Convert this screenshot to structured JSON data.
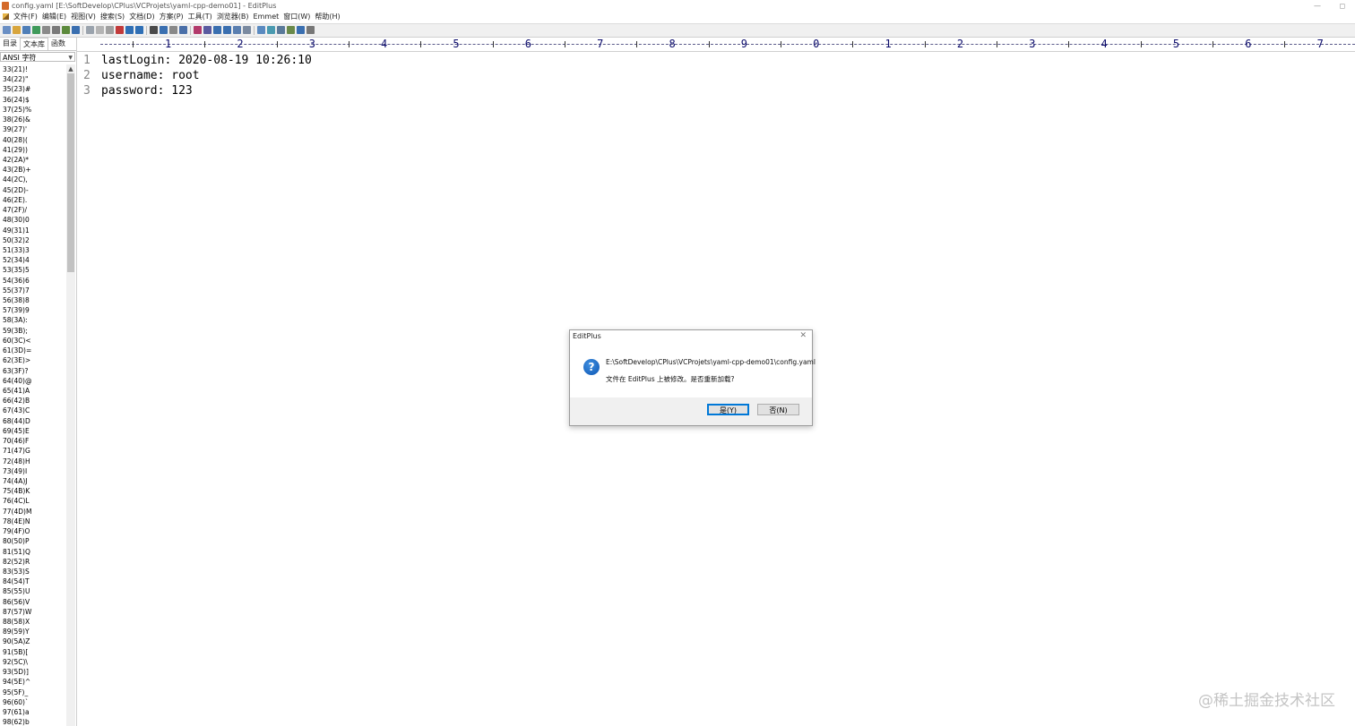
{
  "window": {
    "title": "config.yaml [E:\\SoftDevelop\\CPlus\\VCProjets\\yaml-cpp-demo01] - EditPlus",
    "minimize": "—",
    "maximize": "◻"
  },
  "menu": [
    "文件(F)",
    "编辑(E)",
    "视图(V)",
    "搜索(S)",
    "文档(D)",
    "方案(P)",
    "工具(T)",
    "浏览器(B)",
    "Emmet",
    "窗口(W)",
    "帮助(H)"
  ],
  "sidebar": {
    "tabs": [
      "目录",
      "文本库",
      "函数"
    ],
    "active_tab": "文本库",
    "charset_select": "ANSI 字符",
    "char_items": [
      "33(21)!",
      "34(22)\"",
      "35(23)#",
      "36(24)$",
      "37(25)%",
      "38(26)&",
      "39(27)'",
      "40(28)(",
      "41(29))",
      "42(2A)*",
      "43(2B)+",
      "44(2C),",
      "45(2D)-",
      "46(2E).",
      "47(2F)/",
      "48(30)0",
      "49(31)1",
      "50(32)2",
      "51(33)3",
      "52(34)4",
      "53(35)5",
      "54(36)6",
      "55(37)7",
      "56(38)8",
      "57(39)9",
      "58(3A):",
      "59(3B);",
      "60(3C)<",
      "61(3D)=",
      "62(3E)>",
      "63(3F)?",
      "64(40)@",
      "65(41)A",
      "66(42)B",
      "67(43)C",
      "68(44)D",
      "69(45)E",
      "70(46)F",
      "71(47)G",
      "72(48)H",
      "73(49)I",
      "74(4A)J",
      "75(4B)K",
      "76(4C)L",
      "77(4D)M",
      "78(4E)N",
      "79(4F)O",
      "80(50)P",
      "81(51)Q",
      "82(52)R",
      "83(53)S",
      "84(54)T",
      "85(55)U",
      "86(56)V",
      "87(57)W",
      "88(58)X",
      "89(59)Y",
      "90(5A)Z",
      "91(5B)[",
      "92(5C)\\",
      "93(5D)]",
      "94(5E)^",
      "95(5F)_",
      "96(60)`",
      "97(61)a",
      "98(62)b"
    ]
  },
  "ruler": {
    "numbers": [
      "1",
      "2",
      "3",
      "4",
      "5",
      "6",
      "7",
      "8",
      "9",
      "0",
      "1",
      "2",
      "3",
      "4",
      "5",
      "6",
      "7"
    ]
  },
  "editor": {
    "lines": [
      {
        "number": "1",
        "text": "lastLogin: 2020-08-19 10:26:10"
      },
      {
        "number": "2",
        "text": "username: root"
      },
      {
        "number": "3",
        "text": "password: 123"
      }
    ]
  },
  "dialog": {
    "title": "EditPlus",
    "close": "✕",
    "icon_glyph": "?",
    "path": "E:\\SoftDevelop\\CPlus\\VCProjets\\yaml-cpp-demo01\\config.yaml",
    "message": "文件在 EditPlus 上被修改。是否重新加载?",
    "yes_label": "是(Y)",
    "no_label": "否(N)"
  },
  "watermark": "@稀土掘金技术社区",
  "icons": {
    "toolbar": [
      "new-file-icon",
      "open-file-icon",
      "save-icon",
      "save-all-icon",
      "print-preview-icon",
      "print-icon",
      "spellcheck-icon",
      "browser-icon",
      "cut-icon",
      "copy-icon",
      "paste-icon",
      "delete-icon",
      "undo-icon",
      "redo-icon",
      "find-icon",
      "replace-icon",
      "goto-icon",
      "indent-icon",
      "font-icon",
      "hex-icon",
      "wordwrap-icon",
      "ruler-icon",
      "line-number-icon",
      "settings-icon",
      "dir-window-icon",
      "cliptext-icon",
      "output-window-icon",
      "fullscreen-icon",
      "help-icon",
      "menu-more-icon"
    ]
  },
  "colors": {
    "ruler_numbers": "#0b0b6b",
    "dialog_button_focus": "#0078d7",
    "question_icon": "#0d56b3"
  }
}
